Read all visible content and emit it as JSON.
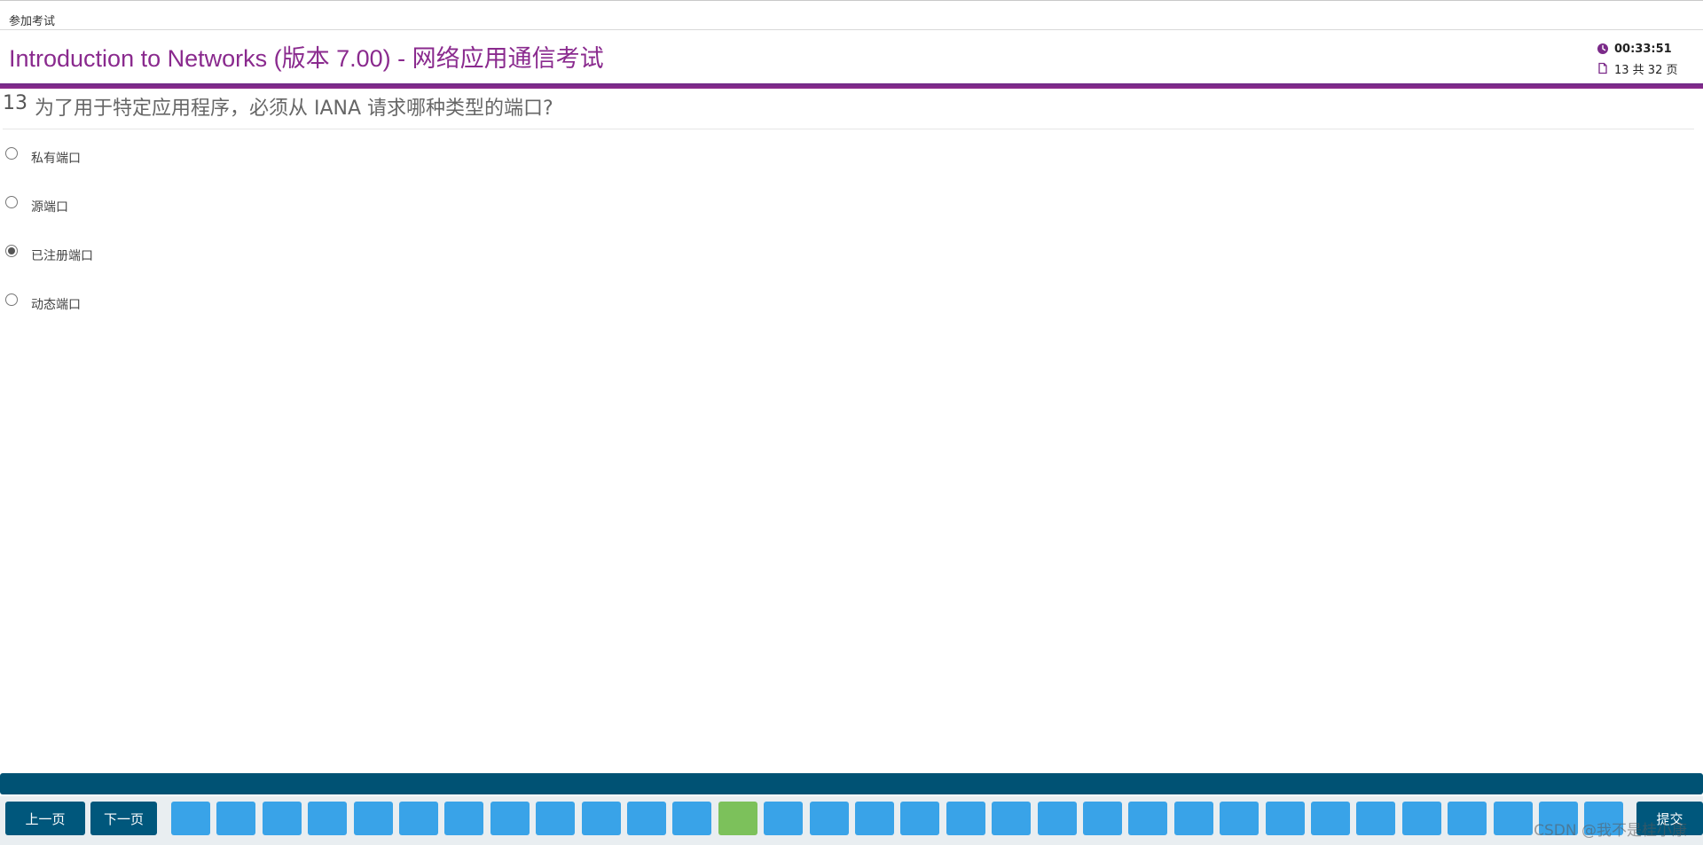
{
  "breadcrumb": "参加考试",
  "exam_title": "Introduction to Networks (版本 7.00) - 网络应用通信考试",
  "timer": "00:33:51",
  "page_indicator": "13 共 32 页",
  "question": {
    "number": "13",
    "text": "为了用于特定应用程序，必须从 IANA 请求哪种类型的端口?"
  },
  "options": [
    {
      "label": "私有端口",
      "selected": false
    },
    {
      "label": "源端口",
      "selected": false
    },
    {
      "label": "已注册端口",
      "selected": true
    },
    {
      "label": "动态端口",
      "selected": false
    }
  ],
  "nav": {
    "prev_label": "上一页",
    "next_label": "下一页",
    "submit_label": "提交"
  },
  "question_navigator": {
    "total_visible": 32,
    "current_index": 12
  },
  "watermark": "CSDN @我不是桂小康",
  "colors": {
    "title_purple": "#8a2a8e",
    "nav_dark": "#00577c",
    "box_blue": "#39a3e8",
    "box_current": "#7cc15b"
  },
  "icons": {
    "timer": "clock-icon",
    "page": "document-icon"
  }
}
